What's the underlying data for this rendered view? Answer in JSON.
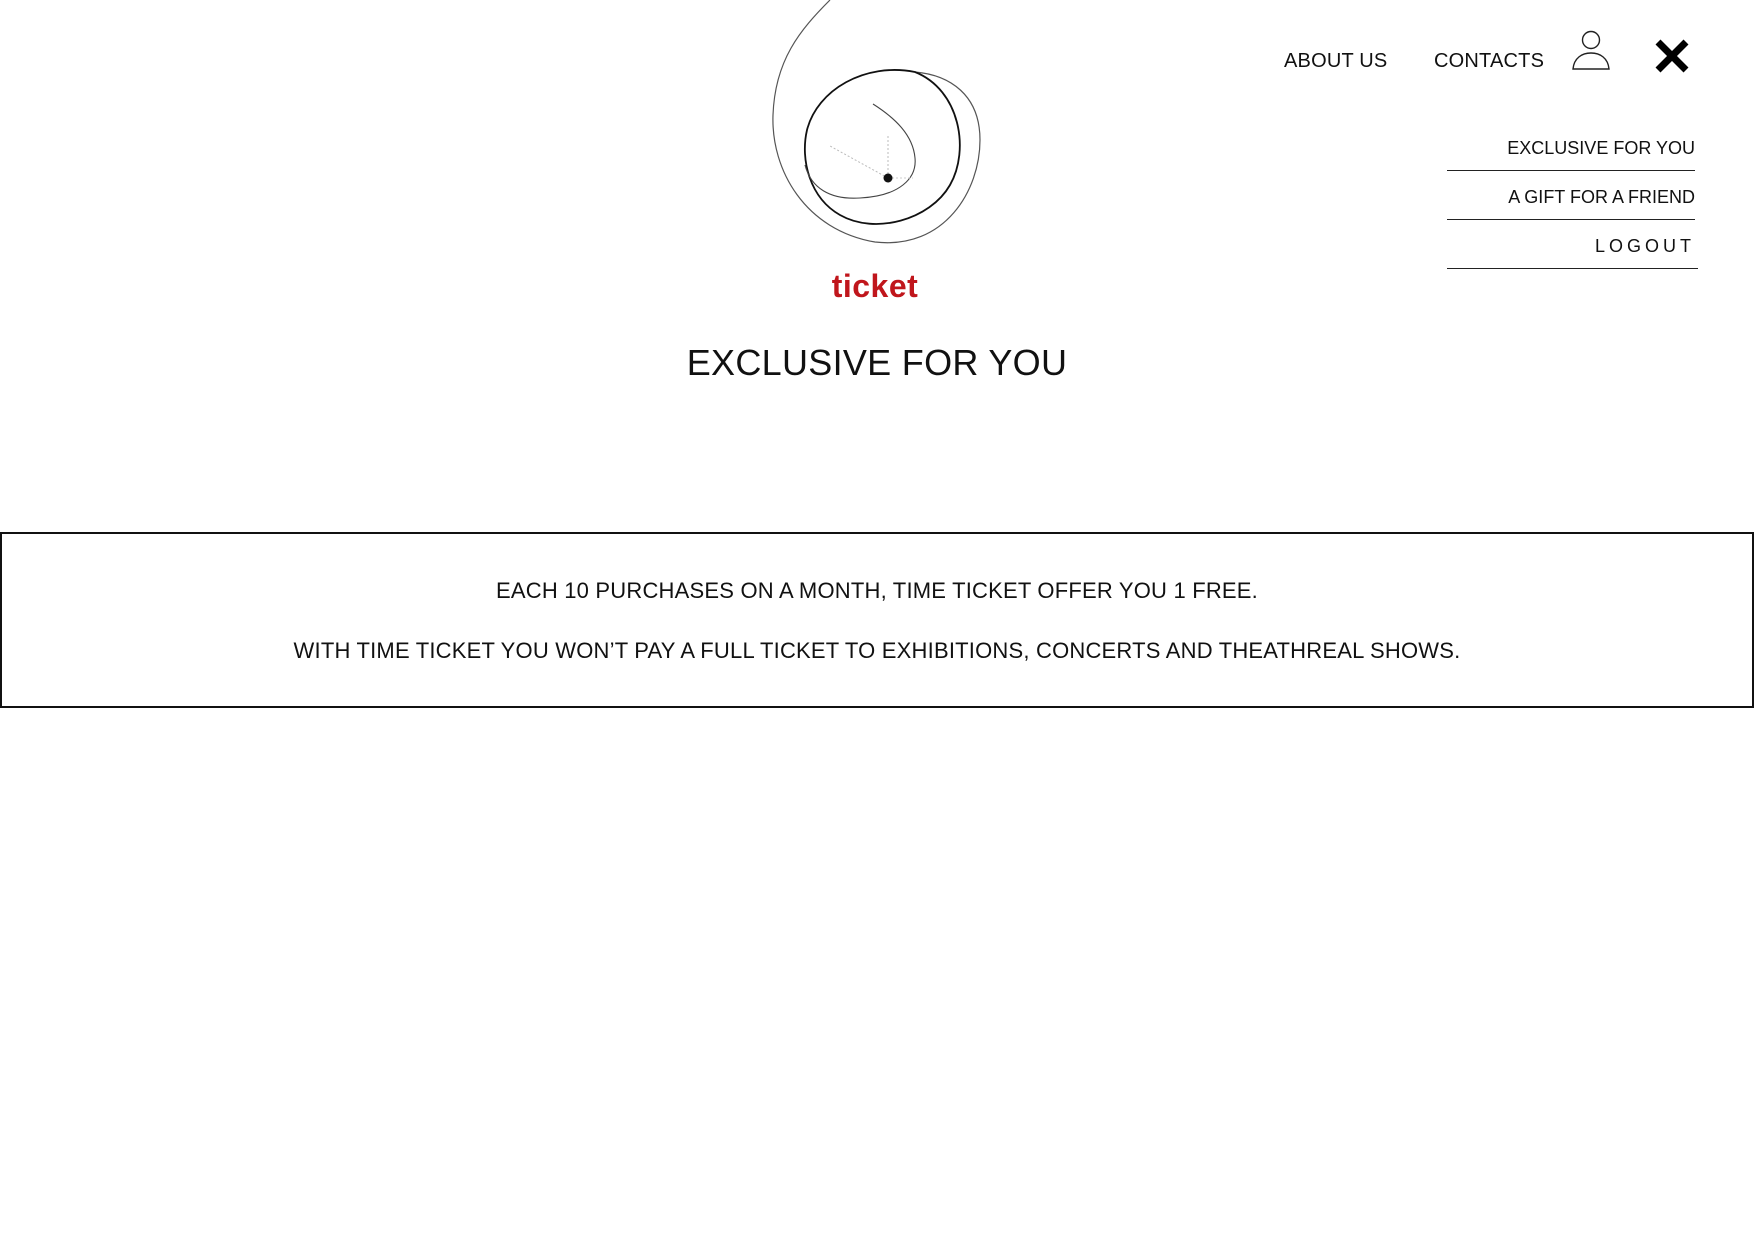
{
  "brand": {
    "logo_word": "ticket",
    "logo_icon": "clock-swirl-icon",
    "accent_color": "#c0161c"
  },
  "nav": {
    "about": "ABOUT US",
    "contacts": "CONTACTS",
    "user_icon": "user-icon",
    "close_icon": "close-icon"
  },
  "menu": {
    "items": [
      {
        "label": "EXCLUSIVE FOR YOU"
      },
      {
        "label": "A GIFT FOR A FRIEND"
      },
      {
        "label": "LOGOUT"
      }
    ]
  },
  "page": {
    "title": "EXCLUSIVE FOR YOU"
  },
  "offer": {
    "line1": "EACH 10 PURCHASES ON A MONTH, TIME TICKET OFFER YOU 1 FREE.",
    "line2": "WITH TIME TICKET YOU WON’T PAY A FULL TICKET TO EXHIBITIONS, CONCERTS AND THEATHREAL SHOWS."
  }
}
